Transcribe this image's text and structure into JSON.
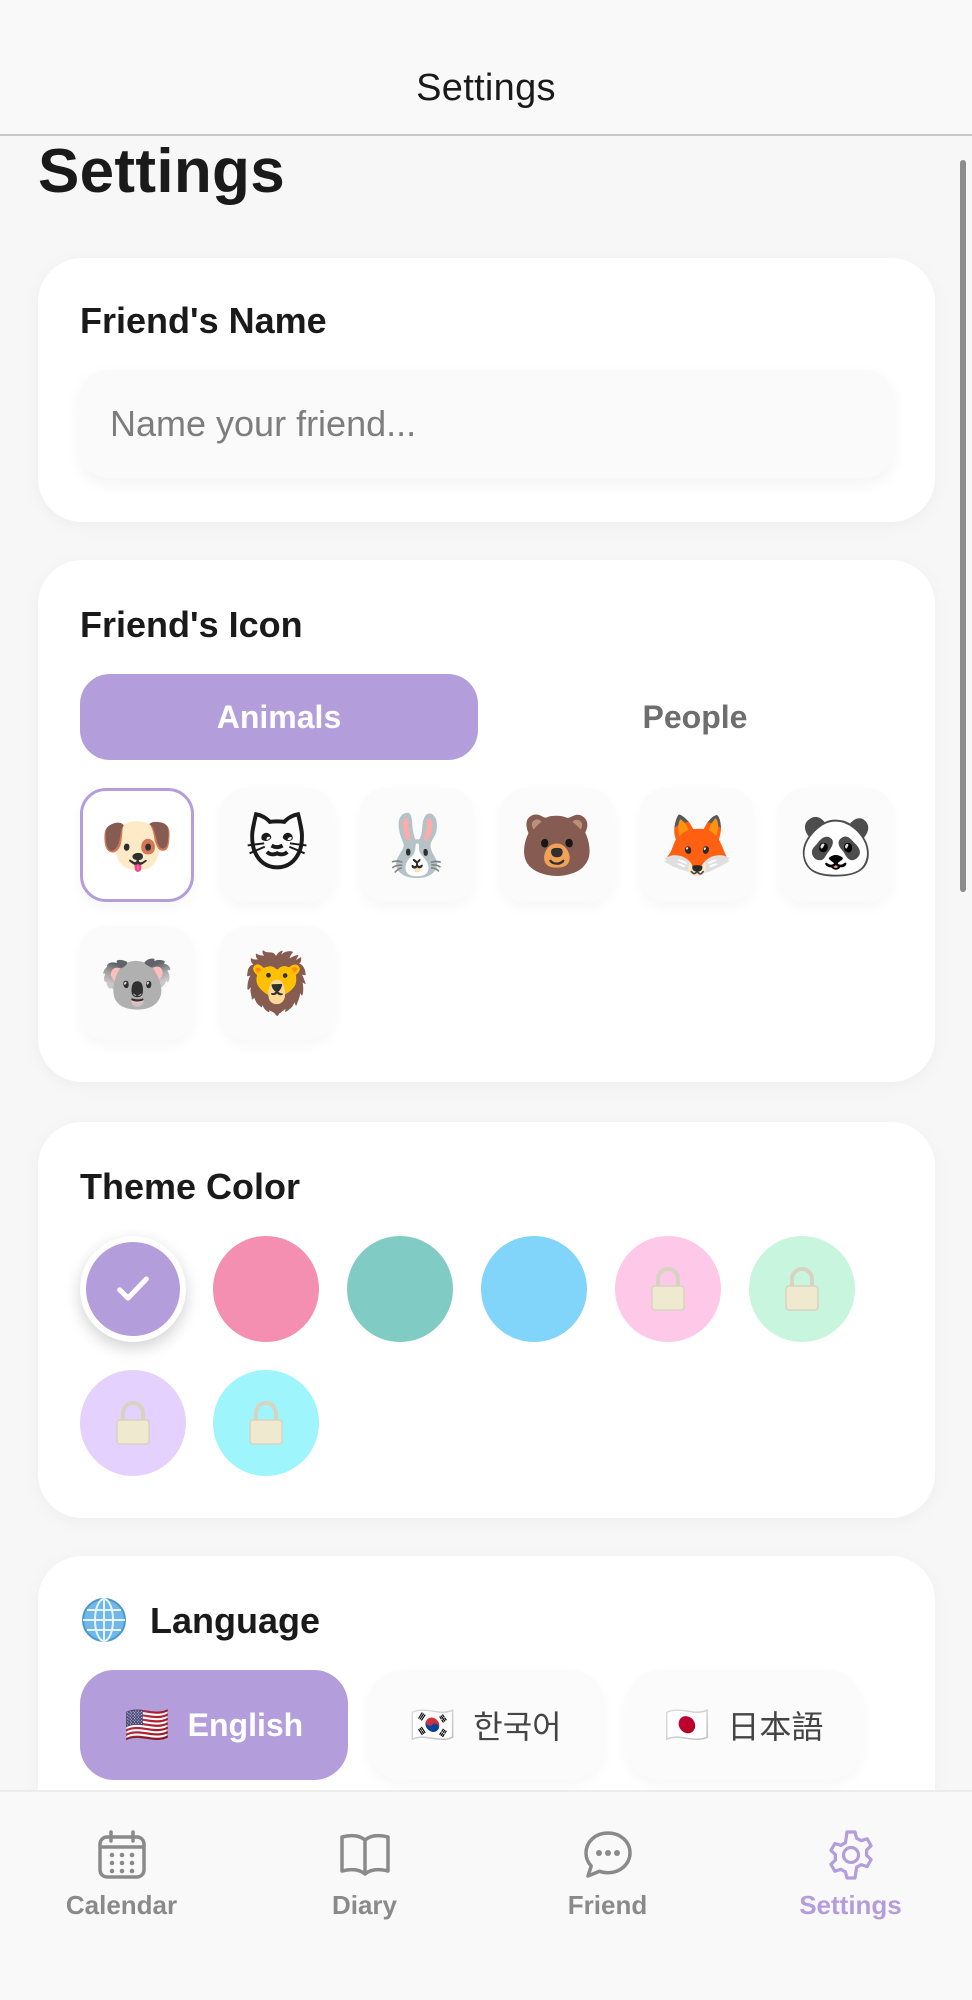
{
  "nav": {
    "title": "Settings"
  },
  "page": {
    "large_title": "Settings"
  },
  "friend_name": {
    "title": "Friend's Name",
    "input_value": "",
    "placeholder": "Name your friend..."
  },
  "friend_icon": {
    "title": "Friend's Icon",
    "tabs": [
      {
        "label": "Animals",
        "selected": true
      },
      {
        "label": "People",
        "selected": false
      }
    ],
    "icons": [
      {
        "emoji": "🐶",
        "name": "dog",
        "selected": true
      },
      {
        "emoji": "🐱",
        "name": "cat",
        "selected": false
      },
      {
        "emoji": "🐰",
        "name": "rabbit",
        "selected": false
      },
      {
        "emoji": "🐻",
        "name": "bear",
        "selected": false
      },
      {
        "emoji": "🦊",
        "name": "fox",
        "selected": false
      },
      {
        "emoji": "🐼",
        "name": "panda",
        "selected": false
      },
      {
        "emoji": "🐨",
        "name": "koala",
        "selected": false
      },
      {
        "emoji": "🦁",
        "name": "lion",
        "selected": false
      }
    ]
  },
  "theme_color": {
    "title": "Theme Color",
    "swatches": [
      {
        "color": "#b39ddb",
        "state": "selected"
      },
      {
        "color": "#f48fb1",
        "state": "available"
      },
      {
        "color": "#80cbc4",
        "state": "available"
      },
      {
        "color": "#81d4fa",
        "state": "available"
      },
      {
        "color": "#fec8e9",
        "state": "locked"
      },
      {
        "color": "#c8f5de",
        "state": "locked"
      },
      {
        "color": "#e5d1fd",
        "state": "locked"
      },
      {
        "color": "#9ef5fc",
        "state": "locked"
      }
    ]
  },
  "language": {
    "title": "Language",
    "options": [
      {
        "flag": "🇺🇸",
        "label": "English",
        "selected": true
      },
      {
        "flag": "🇰🇷",
        "label": "한국어",
        "selected": false
      },
      {
        "flag": "🇯🇵",
        "label": "日本語",
        "selected": false
      }
    ]
  },
  "tab_bar": {
    "items": [
      {
        "label": "Calendar",
        "icon": "calendar-icon",
        "active": false
      },
      {
        "label": "Diary",
        "icon": "book-icon",
        "active": false
      },
      {
        "label": "Friend",
        "icon": "chat-bubble-icon",
        "active": false
      },
      {
        "label": "Settings",
        "icon": "gear-icon",
        "active": true
      }
    ]
  },
  "colors": {
    "accent": "#b39ddb",
    "inactive_tab": "#8a8a8a"
  }
}
